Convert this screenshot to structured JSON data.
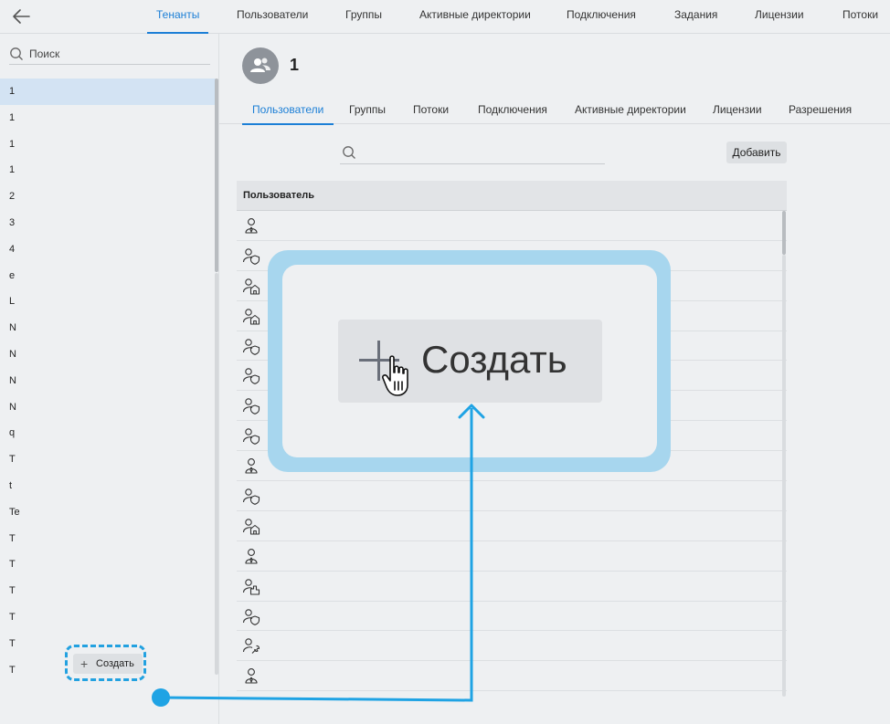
{
  "topnav": {
    "tabs": [
      {
        "label": "Тенанты",
        "active": true
      },
      {
        "label": "Пользователи",
        "active": false
      },
      {
        "label": "Группы",
        "active": false
      },
      {
        "label": "Активные директории",
        "active": false
      },
      {
        "label": "Подключения",
        "active": false
      },
      {
        "label": "Задания",
        "active": false
      },
      {
        "label": "Лицензии",
        "active": false
      },
      {
        "label": "Потоки",
        "active": false
      }
    ]
  },
  "sidebar": {
    "search_placeholder": "Поиск",
    "items": [
      "1",
      "1",
      "1",
      "1",
      "2",
      "3",
      "4",
      "e",
      "L",
      "N",
      "N",
      "N",
      "N",
      "q",
      "T",
      "t",
      "Te",
      "T",
      "T",
      "T",
      "T",
      "T",
      "T"
    ],
    "create_label": "Создать"
  },
  "tenant": {
    "title": "1",
    "tabs": [
      {
        "label": "Пользователи",
        "active": true
      },
      {
        "label": "Группы",
        "active": false
      },
      {
        "label": "Потоки",
        "active": false
      },
      {
        "label": "Подключения",
        "active": false
      },
      {
        "label": "Активные директории",
        "active": false
      },
      {
        "label": "Лицензии",
        "active": false
      },
      {
        "label": "Разрешения",
        "active": false
      }
    ],
    "add_label": "Добавить",
    "table_header": "Пользователь",
    "rows": [
      "user-tie-icon",
      "user-shield-icon",
      "user-home-icon",
      "user-home-icon",
      "user-shield-icon",
      "user-shield-icon",
      "user-shield-icon",
      "user-shield-icon",
      "user-tie-icon",
      "user-shield-icon",
      "user-home-icon",
      "user-tie-icon",
      "user-building-icon",
      "user-shield-icon",
      "user-wrench-icon",
      "user-tie-icon"
    ]
  },
  "callout": {
    "label": "Создать"
  },
  "colors": {
    "accent": "#1c7fd6",
    "highlight": "#22a1e0",
    "callout_bg": "#a7d6ee"
  }
}
